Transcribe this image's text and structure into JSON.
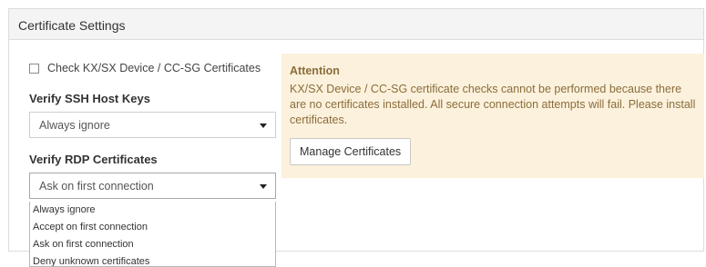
{
  "panel": {
    "title": "Certificate Settings"
  },
  "check_certificates": {
    "label": "Check KX/SX Device / CC-SG Certificates",
    "checked": false
  },
  "ssh_host_keys": {
    "label": "Verify SSH Host Keys",
    "value": "Always ignore"
  },
  "rdp_certificates": {
    "label": "Verify RDP Certificates",
    "value": "Ask on first connection",
    "dropdown_open": true,
    "options": [
      "Always ignore",
      "Accept on first connection",
      "Ask on first connection",
      "Deny unknown certificates"
    ]
  },
  "attention": {
    "title": "Attention",
    "message": "KX/SX Device / CC-SG certificate checks cannot be performed because there are no certificates installed. All secure connection attempts will fail. Please install certificates.",
    "button_label": "Manage Certificates",
    "background_color": "#fcf1dc",
    "text_color": "#8a6d3b"
  },
  "icons": {
    "dropdown": "chevron-down-icon"
  }
}
